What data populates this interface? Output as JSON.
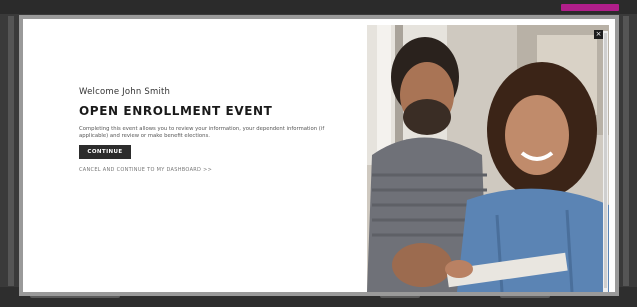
{
  "modal": {
    "welcome": "Welcome John Smith",
    "title": "OPEN ENROLLMENT EVENT",
    "description": "Completing this event allows you to review your information, your dependent information (if applicable) and review or make benefit elections.",
    "continue_label": "CONTINUE",
    "skip_label": "CANCEL AND CONTINUE TO MY DASHBOARD >>",
    "close_label": "×"
  },
  "colors": {
    "button": "#2c2c2c",
    "badge": "#b01e8a"
  }
}
